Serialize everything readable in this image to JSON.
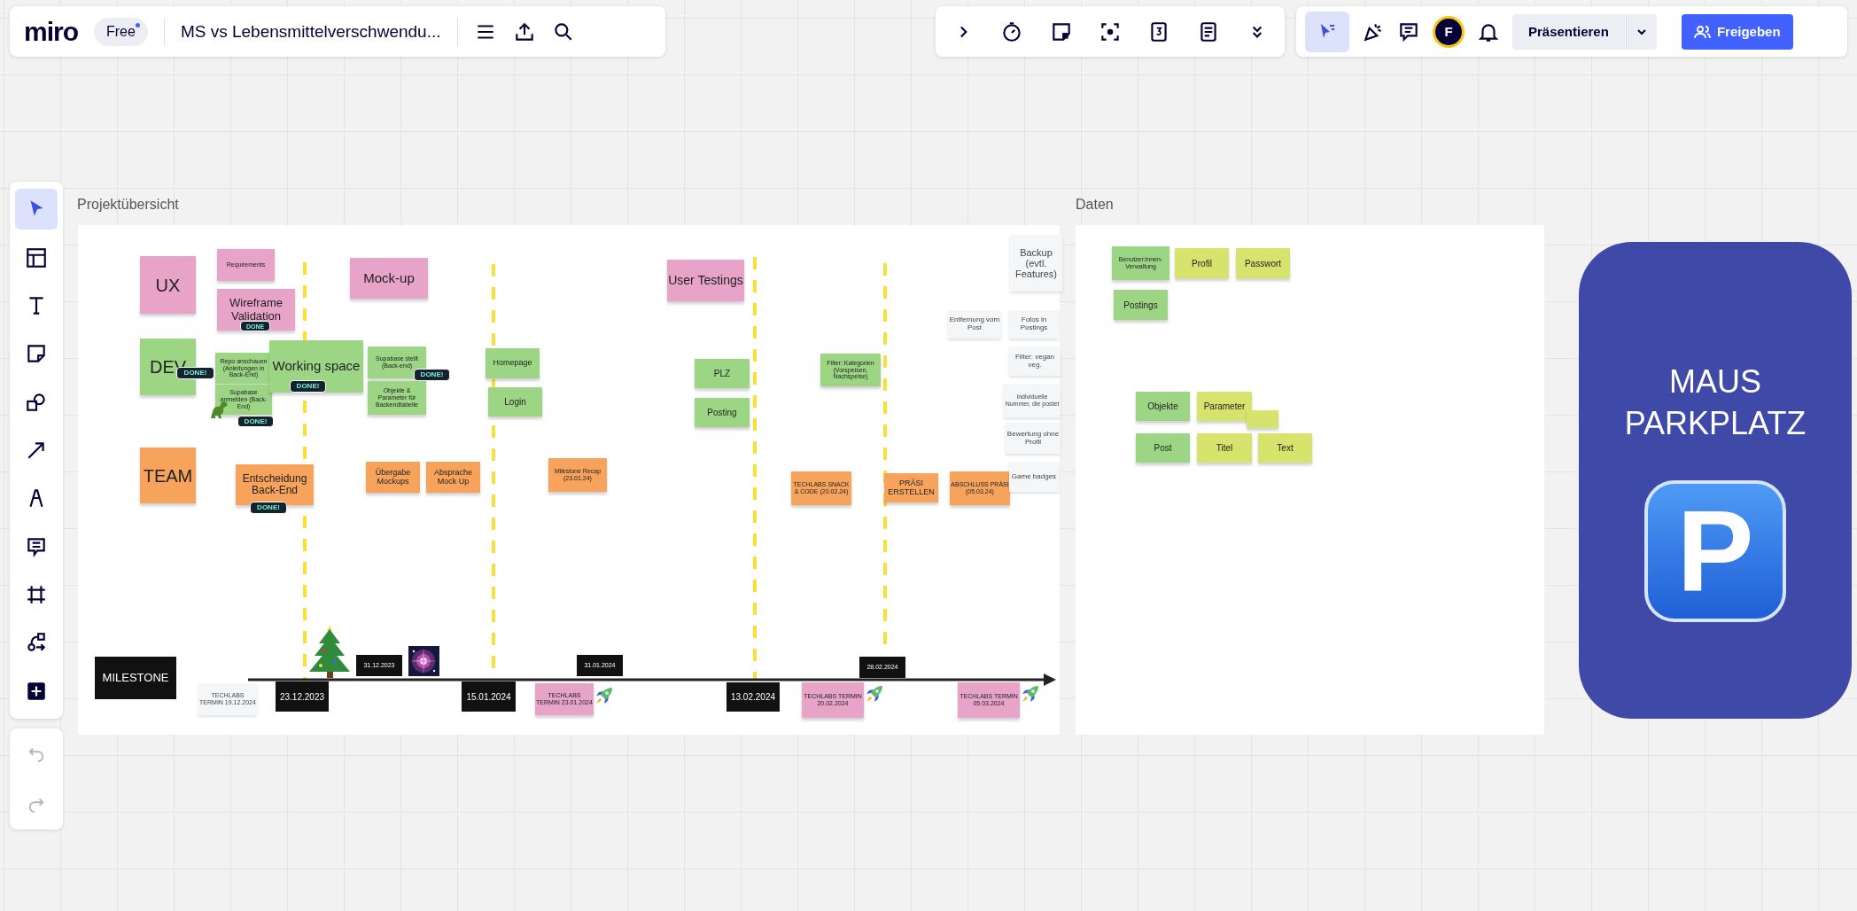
{
  "topbar": {
    "logo": "miro",
    "plan_badge": "Free",
    "board_title": "MS vs Lebensmittelverschwendu...",
    "avatar": "F",
    "present_button": "Präsentieren",
    "share_button": "Freigeben"
  },
  "left_tools": [
    {
      "kind": "select",
      "selected": true
    },
    {
      "kind": "templates",
      "selected": false
    },
    {
      "kind": "text",
      "selected": false
    },
    {
      "kind": "sticky",
      "selected": false
    },
    {
      "kind": "shapes",
      "selected": false
    },
    {
      "kind": "arrow",
      "selected": false
    },
    {
      "kind": "pen",
      "selected": false
    },
    {
      "kind": "comment",
      "selected": false
    },
    {
      "kind": "frame",
      "selected": false
    },
    {
      "kind": "diagram",
      "selected": false
    },
    {
      "kind": "add",
      "selected": false
    }
  ],
  "history": [
    {
      "kind": "undo",
      "disabled": true
    },
    {
      "kind": "redo",
      "disabled": true
    }
  ],
  "overview_frame": {
    "title": "Projektübersicht",
    "notes": [
      {
        "text": "UX",
        "kind": "sticky",
        "color": "#e8a3c9"
      },
      {
        "text": "Requirements",
        "kind": "sticky",
        "color": "#e8a3c9"
      },
      {
        "text": "Wireframe Validation",
        "kind": "sticky",
        "color": "#e8a3c9"
      },
      {
        "text": "Mock-up",
        "kind": "sticky",
        "color": "#e8a3c9"
      },
      {
        "text": "DEV",
        "kind": "sticky",
        "color": "#9cd685"
      },
      {
        "text": "Repo anschauen (Anleitungen in Back-End)",
        "kind": "sticky",
        "color": "#9cd685"
      },
      {
        "text": "Supabase anmelden (Back-End)",
        "kind": "sticky",
        "color": "#9cd685"
      },
      {
        "text": "Working space",
        "kind": "sticky",
        "color": "#9cd685"
      },
      {
        "text": "Supabase stellt (Back-end)",
        "kind": "sticky",
        "color": "#9cd685"
      },
      {
        "text": "Objekte & Parameter für Backendtabelle",
        "kind": "sticky",
        "color": "#9cd685"
      },
      {
        "text": "Homepage",
        "kind": "sticky",
        "color": "#9cd685"
      },
      {
        "text": "Login",
        "kind": "sticky",
        "color": "#9cd685"
      },
      {
        "text": "User Testings",
        "kind": "sticky",
        "color": "#e8a3c9"
      },
      {
        "text": "PLZ",
        "kind": "sticky",
        "color": "#9cd685"
      },
      {
        "text": "Posting",
        "kind": "sticky",
        "color": "#9cd685"
      },
      {
        "text": "Filter: Kategorien (Vorspeisen, Nachspeise)",
        "kind": "sticky",
        "color": "#9cd685"
      },
      {
        "text": "TEAM",
        "kind": "sticky",
        "color": "#f7a35c"
      },
      {
        "text": "Entscheidung Back-End",
        "kind": "sticky",
        "color": "#f7a35c"
      },
      {
        "text": "Übergabe Mockups",
        "kind": "sticky",
        "color": "#f7a35c"
      },
      {
        "text": "Absprache Mock Up",
        "kind": "sticky",
        "color": "#f7a35c"
      },
      {
        "text": "Milestone Recap (23.01.24)",
        "kind": "sticky",
        "color": "#f7a35c"
      },
      {
        "text": "TECHLABS SNACK & CODE (20.02.24)",
        "kind": "sticky",
        "color": "#f7a35c"
      },
      {
        "text": "PRÄSI ERSTELLEN",
        "kind": "sticky",
        "color": "#f7a35c"
      },
      {
        "text": "ABSCHLUSS PRÄSI (05.03.24)",
        "kind": "sticky",
        "color": "#f7a35c"
      },
      {
        "text": "Backup (evtl. Features)",
        "kind": "card",
        "color": "#f5f6f7"
      },
      {
        "text": "Entfernung vom Post",
        "kind": "card",
        "color": "#f5f6f7"
      },
      {
        "text": "Fotos in Postings",
        "kind": "card",
        "color": "#f5f6f7"
      },
      {
        "text": "Filter: vegan veg.",
        "kind": "card",
        "color": "#f5f6f7"
      },
      {
        "text": "individuelle Nummer, die postet",
        "kind": "card",
        "color": "#f5f6f7"
      },
      {
        "text": "Bewertung ohne Profil",
        "kind": "card",
        "color": "#f5f6f7"
      },
      {
        "text": "Game badges",
        "kind": "card",
        "color": "#f5f6f7"
      },
      {
        "text": "MILESTONE",
        "kind": "tag",
        "color": "#111111"
      },
      {
        "text": "TECHLABS TERMIN 19.12.2024",
        "kind": "card",
        "color": "#f5f6f7"
      },
      {
        "text": "23.12.2023",
        "kind": "tag",
        "color": "#111111"
      },
      {
        "text": "31.12.2023",
        "kind": "tag",
        "color": "#111111"
      },
      {
        "text": "15.01.2024",
        "kind": "tag",
        "color": "#111111"
      },
      {
        "text": "31.01.2024",
        "kind": "tag",
        "color": "#111111"
      },
      {
        "text": "TECHLABS TERMIN 23.01.2024",
        "kind": "sticky",
        "color": "#e8a3c9"
      },
      {
        "text": "13.02.2024",
        "kind": "tag",
        "color": "#111111"
      },
      {
        "text": "28.02.2024",
        "kind": "tag",
        "color": "#111111"
      },
      {
        "text": "TECHLABS TERMIN 20.02.2024",
        "kind": "sticky",
        "color": "#e8a3c9"
      },
      {
        "text": "TECHLABS TERMIN 05.03.2024",
        "kind": "sticky",
        "color": "#e8a3c9"
      }
    ],
    "done_badges": [
      "DONE!",
      "DONE!",
      "DONE!",
      "DONE!",
      "DONE!",
      "DONE"
    ]
  },
  "data_frame": {
    "title": "Daten",
    "notes": [
      {
        "text": "Benutzer:innen-Verwaltung",
        "kind": "sticky",
        "color": "#9cd685"
      },
      {
        "text": "Profil",
        "kind": "sticky",
        "color": "#d6e36d"
      },
      {
        "text": "Passwort",
        "kind": "sticky",
        "color": "#d6e36d"
      },
      {
        "text": "Postings",
        "kind": "sticky",
        "color": "#9cd685"
      },
      {
        "text": "Objekte",
        "kind": "sticky",
        "color": "#9cd685"
      },
      {
        "text": "Parameter",
        "kind": "sticky",
        "color": "#d6e36d"
      },
      {
        "text": "Post",
        "kind": "sticky",
        "color": "#9cd685"
      },
      {
        "text": "Titel",
        "kind": "sticky",
        "color": "#d6e36d"
      },
      {
        "text": "Text",
        "kind": "sticky",
        "color": "#d6e36d"
      }
    ]
  },
  "parking": {
    "title": "MAUS PARKPLATZ",
    "sign_letter": "P"
  }
}
